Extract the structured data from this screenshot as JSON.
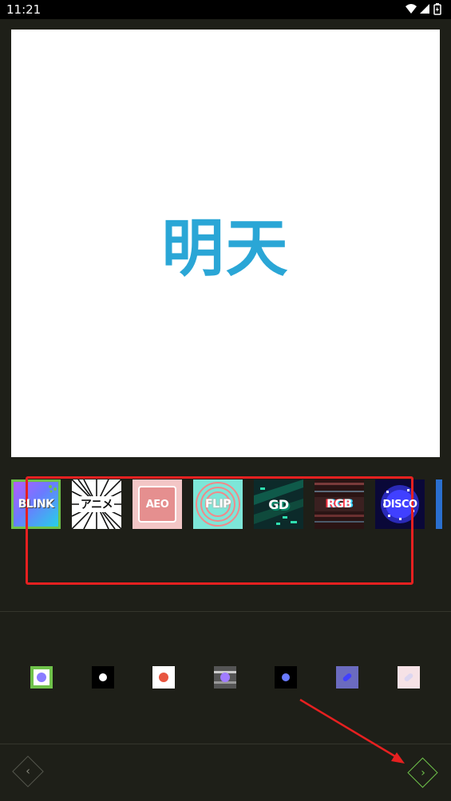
{
  "status": {
    "time": "11:21"
  },
  "canvas": {
    "text": "明天"
  },
  "effects": [
    {
      "label": "BLINK"
    },
    {
      "label": "アニメ"
    },
    {
      "label": "AEO"
    },
    {
      "label": "FLIP"
    },
    {
      "label": "GD"
    },
    {
      "label": "RGB"
    },
    {
      "label": "DISCO"
    }
  ],
  "colors": {
    "accent": "#6fc24a",
    "text_color": "#2aa6d6",
    "annotation": "#e62020"
  },
  "navigation": {
    "prev_icon": "chevron-left-icon",
    "next_icon": "chevron-right-icon"
  }
}
